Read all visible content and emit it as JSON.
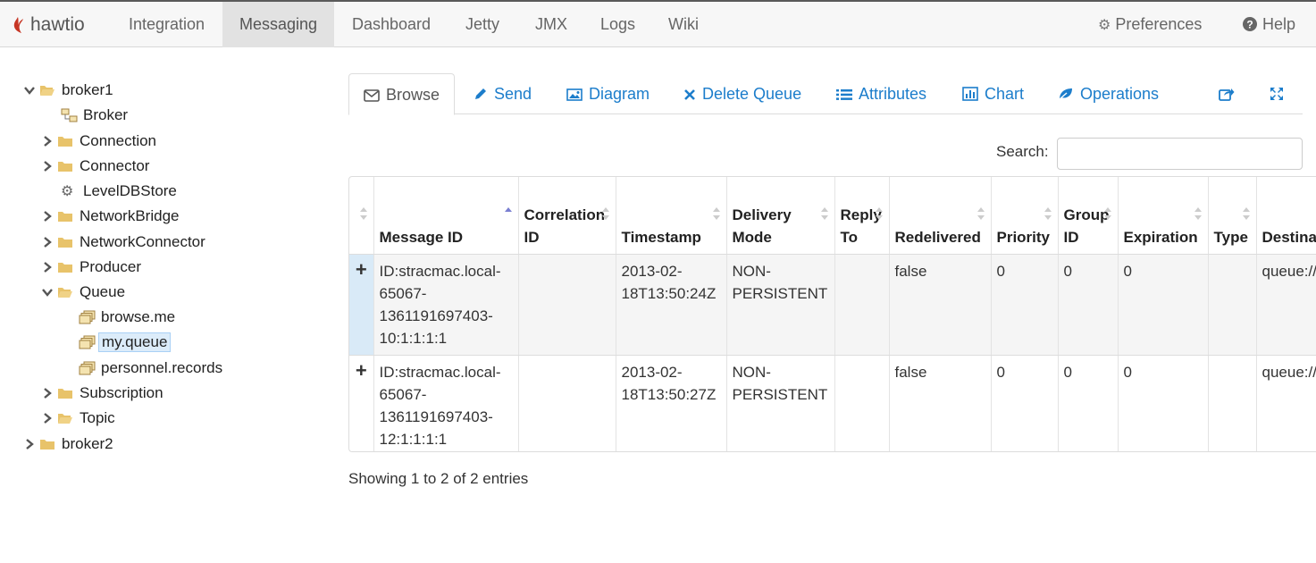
{
  "nav": {
    "brand": "hawtio",
    "links": [
      "Integration",
      "Messaging",
      "Dashboard",
      "Jetty",
      "JMX",
      "Logs",
      "Wiki"
    ],
    "active": "Messaging",
    "preferences": "Preferences",
    "help": "Help"
  },
  "tree": {
    "broker1": "broker1",
    "broker": "Broker",
    "connection": "Connection",
    "connector": "Connector",
    "leveldb": "LevelDBStore",
    "networkbridge": "NetworkBridge",
    "networkconnector": "NetworkConnector",
    "producer": "Producer",
    "queue": "Queue",
    "browse_me": "browse.me",
    "my_queue": "my.queue",
    "personnel": "personnel.records",
    "subscription": "Subscription",
    "topic": "Topic",
    "broker2": "broker2"
  },
  "tabs": {
    "browse": "Browse",
    "send": "Send",
    "diagram": "Diagram",
    "delete_queue": "Delete Queue",
    "attributes": "Attributes",
    "chart": "Chart",
    "operations": "Operations"
  },
  "search": {
    "label": "Search:",
    "value": ""
  },
  "table": {
    "headers": {
      "message_id": "Message ID",
      "correlation_id": "Correlation ID",
      "timestamp": "Timestamp",
      "delivery_mode": "Delivery Mode",
      "reply_to": "Reply To",
      "redelivered": "Redelivered",
      "priority": "Priority",
      "group_id": "Group ID",
      "expiration": "Expiration",
      "type": "Type",
      "destination": "Destination"
    },
    "rows": [
      {
        "expand": "+",
        "message_id": "ID:stracmac.local-65067-1361191697403-10:1:1:1:1",
        "correlation_id": "",
        "timestamp": "2013-02-18T13:50:24Z",
        "delivery_mode": "NON-PERSISTENT",
        "reply_to": "",
        "redelivered": "false",
        "priority": "0",
        "group_id": "0",
        "expiration": "0",
        "type": "",
        "destination": "queue://my.queue"
      },
      {
        "expand": "+",
        "message_id": "ID:stracmac.local-65067-1361191697403-12:1:1:1:1",
        "correlation_id": "",
        "timestamp": "2013-02-18T13:50:27Z",
        "delivery_mode": "NON-PERSISTENT",
        "reply_to": "",
        "redelivered": "false",
        "priority": "0",
        "group_id": "0",
        "expiration": "0",
        "type": "",
        "destination": "queue://my.queue"
      }
    ]
  },
  "info": "Showing 1 to 2 of 2 entries",
  "colors": {
    "link": "#1c7dcb",
    "folder": "#e8c36a",
    "selected": "#dcecfa"
  }
}
